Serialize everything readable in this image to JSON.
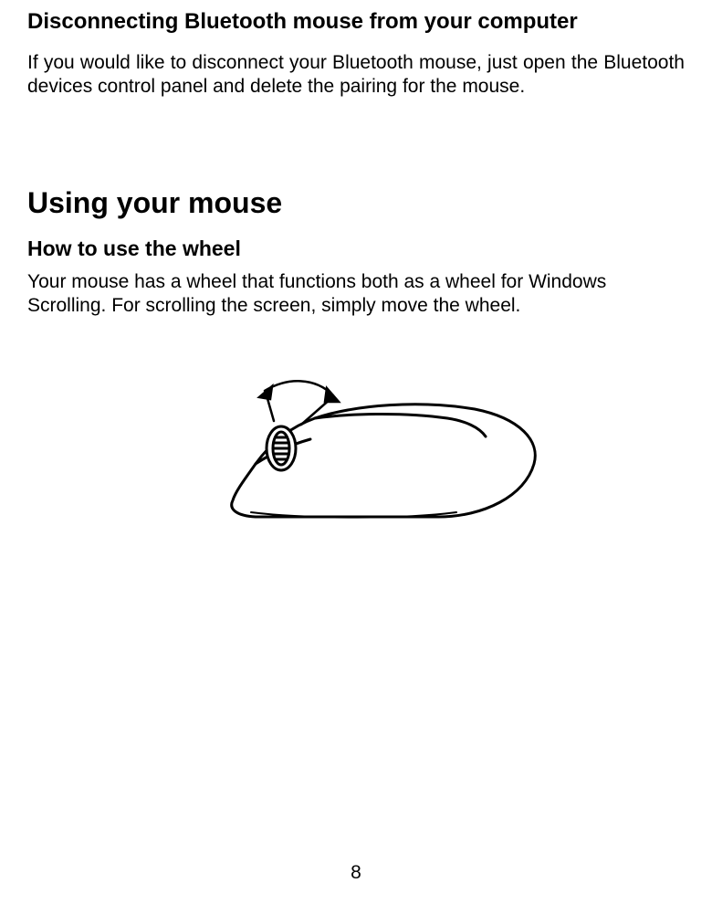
{
  "section1": {
    "heading": "Disconnecting Bluetooth mouse from your computer",
    "body": "If you would like to disconnect your Bluetooth mouse, just open the Bluetooth devices control panel and delete the pairing for the mouse."
  },
  "section2": {
    "heading": "Using your mouse",
    "subheading": "How to use the wheel",
    "body": "Your mouse has a wheel that functions both as a wheel for Windows Scrolling. For scrolling the screen, simply move the wheel."
  },
  "pageNumber": "8"
}
